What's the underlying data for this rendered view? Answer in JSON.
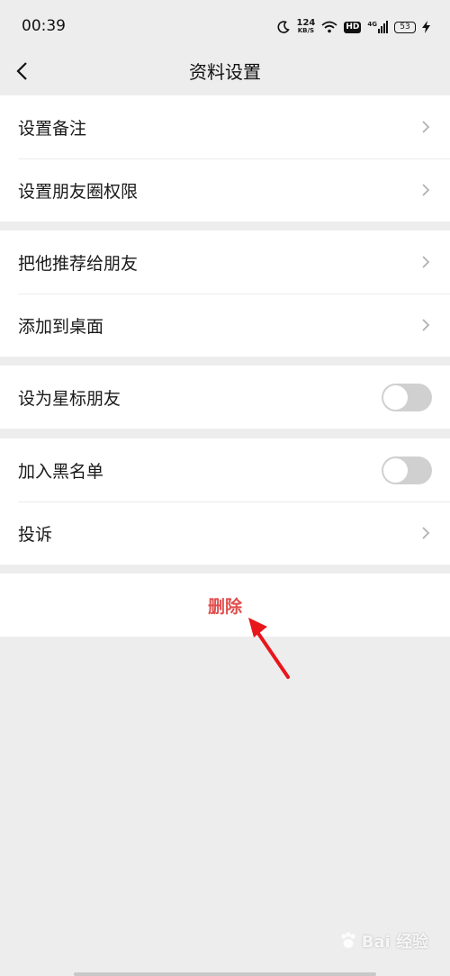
{
  "status_bar": {
    "time": "00:39",
    "speed_value": "124",
    "speed_unit": "KB/S",
    "hd_badge": "HD",
    "signal_label": "4G",
    "battery": "53",
    "icons": [
      "moon-icon",
      "wifi-icon",
      "signal-icon",
      "charging-icon"
    ]
  },
  "header": {
    "title": "资料设置",
    "back_icon": "chevron-left-icon"
  },
  "groups": [
    {
      "rows": [
        {
          "label": "设置备注",
          "control": "chevron"
        },
        {
          "label": "设置朋友圈权限",
          "control": "chevron"
        }
      ]
    },
    {
      "rows": [
        {
          "label": "把他推荐给朋友",
          "control": "chevron"
        },
        {
          "label": "添加到桌面",
          "control": "chevron"
        }
      ]
    },
    {
      "rows": [
        {
          "label": "设为星标朋友",
          "control": "toggle",
          "on": false
        }
      ]
    },
    {
      "rows": [
        {
          "label": "加入黑名单",
          "control": "toggle",
          "on": false
        },
        {
          "label": "投诉",
          "control": "chevron"
        }
      ]
    }
  ],
  "delete": {
    "label": "删除",
    "color": "#e04e4e"
  },
  "annotation": {
    "arrow_color": "#e8161b"
  },
  "watermark": {
    "text": "Bai 经验"
  }
}
